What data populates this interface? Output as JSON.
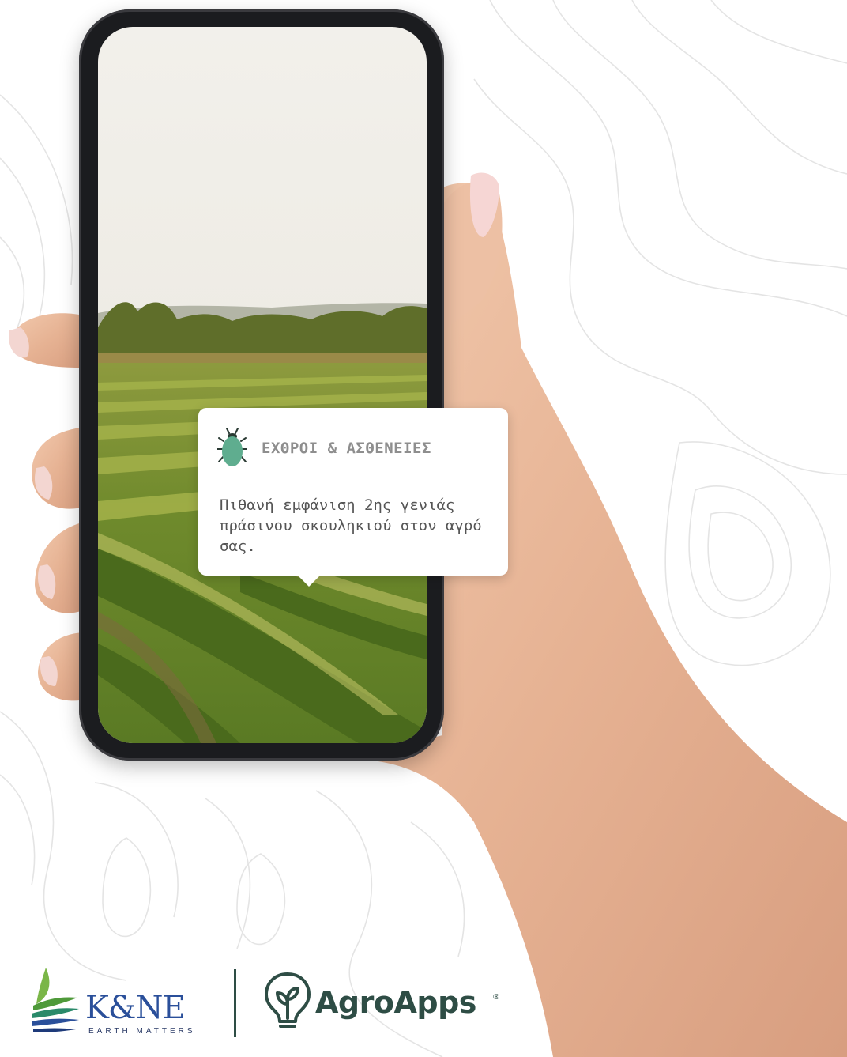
{
  "colors": {
    "background": "#ffffff",
    "topo_lines": "#e3e3e3",
    "skin": "#e8b99a",
    "phone_frame": "#1b1c1f",
    "card_bg": "#ffffff",
    "card_title": "#8e8e8e",
    "card_text": "#555555",
    "bug_icon": "#5fad8f",
    "kne_blue": "#2a4f9a",
    "kne_green": "#7ab648",
    "agro_green": "#2e4d45"
  },
  "notification": {
    "icon": "bug-icon",
    "title": "ΕΧΘΡΟΙ & ΑΣΘΕΝΕΙΕΣ",
    "message": "Πιθανή εμφάνιση 2ης γενιάς πράσινου σκουληκιού στον αγρό σας."
  },
  "footer": {
    "kne": {
      "name": "K&NE",
      "tagline": "EARTH MATTERS"
    },
    "agroapps": {
      "icon": "bulb-sprout-icon",
      "name": "AgroApps",
      "registered": "®"
    }
  }
}
